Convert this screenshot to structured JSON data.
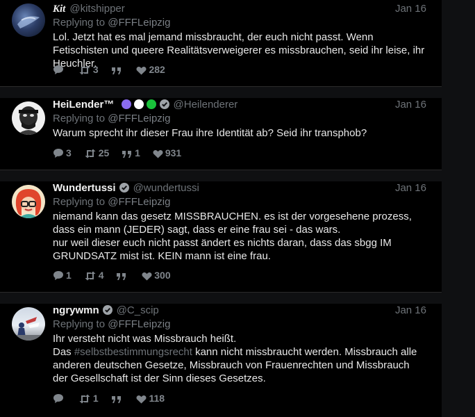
{
  "colors": {
    "background": "#000000",
    "muted": "#6e7378",
    "text": "#e8e8e8"
  },
  "tweets": [
    {
      "name": "Kit",
      "handle": "@kitshipper",
      "date": "Jan 16",
      "replying_prefix": "Replying to ",
      "replying_to": "@FFFLeipzig",
      "text": "Lol. Jetzt hat es mal jemand missbraucht, der euch nicht passt. Wenn Fetischisten und queere Realitätsverweigerer es missbrauchen, seid ihr leise, ihr Heuchler.",
      "reply_count": "",
      "retweet_count": "3",
      "quote_count": "",
      "like_count": "282"
    },
    {
      "name": "HeiLender™",
      "handle": "@Heilenderer",
      "date": "Jan 16",
      "replying_prefix": "Replying to ",
      "replying_to": "@FFFLeipzig",
      "text": "Warum sprecht ihr dieser Frau ihre Identität ab? Seid ihr transphob?",
      "reply_count": "3",
      "retweet_count": "25",
      "quote_count": "1",
      "like_count": "931",
      "name_badges": [
        "#8b6cf0",
        "#ffffff",
        "#19c23a"
      ]
    },
    {
      "name": "Wundertussi",
      "handle": "@wundertussi",
      "date": "Jan 16",
      "replying_prefix": "Replying to ",
      "replying_to": "@FFFLeipzig",
      "text": "niemand kann das gesetz MISSBRAUCHEN. es ist der vorgesehene prozess, dass ein mann (JEDER) sagt, dass er eine frau sei - das wars.\nnur weil dieser euch nicht passt ändert es nichts daran, dass das sbgg IM GRUNDSATZ mist ist. KEIN mann ist eine frau.",
      "reply_count": "1",
      "retweet_count": "4",
      "quote_count": "",
      "like_count": "300"
    },
    {
      "name": "ngrywmn",
      "handle": "@C_scip",
      "date": "Jan 16",
      "replying_prefix": "Replying to ",
      "replying_to": "@FFFLeipzig",
      "text_line1": "Ihr versteht nicht was Missbrauch heißt.",
      "text_pre": "Das ",
      "hashtag": "#selbstbestimmungsrecht",
      "text_post": " kann nicht missbraucht werden. Missbrauch alle anderen deutschen Gesetze, Missbrauch von Frauenrechten und Missbrauch der Gesellschaft ist der Sinn dieses Gesetzes.",
      "reply_count": "",
      "retweet_count": "1",
      "quote_count": "",
      "like_count": "118"
    }
  ]
}
